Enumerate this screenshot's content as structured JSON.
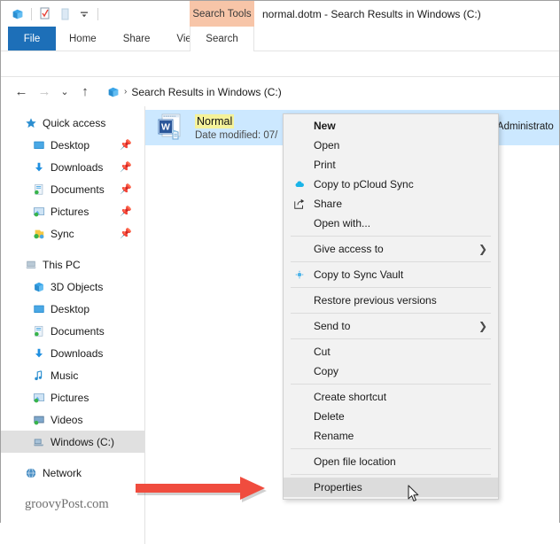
{
  "titlebar": {
    "quick_access_icons": [
      "explorer-icon",
      "properties-icon",
      "new-folder-icon",
      "customize-dropdown-icon"
    ],
    "contextual_tab_label": "Search Tools",
    "window_title": "normal.dotm - Search Results in Windows (C:)"
  },
  "ribbon": {
    "tabs": [
      {
        "label": "File",
        "active": true
      },
      {
        "label": "Home",
        "active": false
      },
      {
        "label": "Share",
        "active": false
      },
      {
        "label": "View",
        "active": false
      }
    ],
    "contextual_tab": {
      "label": "Search"
    }
  },
  "addressbar": {
    "back_label": "←",
    "forward_label": "→",
    "recent_label": "⌄",
    "up_label": "↑",
    "breadcrumb_chevron": "›",
    "path": "Search Results in Windows (C:)"
  },
  "sidebar": {
    "groups": [
      {
        "header": {
          "label": "Quick access",
          "icon": "star-icon"
        },
        "items": [
          {
            "label": "Desktop",
            "icon": "desktop-icon",
            "pinned": true
          },
          {
            "label": "Downloads",
            "icon": "downloads-icon",
            "pinned": true
          },
          {
            "label": "Documents",
            "icon": "documents-icon",
            "pinned": true
          },
          {
            "label": "Pictures",
            "icon": "pictures-icon",
            "pinned": true
          },
          {
            "label": "Sync",
            "icon": "sync-icon",
            "pinned": true
          }
        ]
      },
      {
        "header": {
          "label": "This PC",
          "icon": "this-pc-icon"
        },
        "items": [
          {
            "label": "3D Objects",
            "icon": "3d-objects-icon",
            "pinned": false
          },
          {
            "label": "Desktop",
            "icon": "desktop-icon",
            "pinned": false
          },
          {
            "label": "Documents",
            "icon": "documents-icon",
            "pinned": false
          },
          {
            "label": "Downloads",
            "icon": "downloads-icon",
            "pinned": false
          },
          {
            "label": "Music",
            "icon": "music-icon",
            "pinned": false
          },
          {
            "label": "Pictures",
            "icon": "pictures-icon",
            "pinned": false
          },
          {
            "label": "Videos",
            "icon": "videos-icon",
            "pinned": false
          },
          {
            "label": "Windows (C:)",
            "icon": "drive-icon",
            "pinned": false,
            "selected": true
          }
        ]
      },
      {
        "header": {
          "label": "Network",
          "icon": "network-icon"
        },
        "items": []
      }
    ]
  },
  "content": {
    "file": {
      "name": "Normal",
      "icon": "word-template-icon",
      "date_modified": "Date modified: 07/",
      "path": "C:\\Users\\Administrato"
    }
  },
  "context_menu": {
    "items": [
      {
        "label": "New",
        "bold": true,
        "icon": null,
        "submenu": false,
        "separator_after": false
      },
      {
        "label": "Open",
        "bold": false,
        "icon": null,
        "submenu": false,
        "separator_after": false
      },
      {
        "label": "Print",
        "bold": false,
        "icon": null,
        "submenu": false,
        "separator_after": false
      },
      {
        "label": "Copy to pCloud Sync",
        "bold": false,
        "icon": "pcloud-icon",
        "submenu": false,
        "separator_after": false
      },
      {
        "label": "Share",
        "bold": false,
        "icon": "share-icon",
        "submenu": false,
        "separator_after": false
      },
      {
        "label": "Open with...",
        "bold": false,
        "icon": null,
        "submenu": false,
        "separator_after": true
      },
      {
        "label": "Give access to",
        "bold": false,
        "icon": null,
        "submenu": true,
        "separator_after": true
      },
      {
        "label": "Copy to Sync Vault",
        "bold": false,
        "icon": "sync-vault-icon",
        "submenu": false,
        "separator_after": true
      },
      {
        "label": "Restore previous versions",
        "bold": false,
        "icon": null,
        "submenu": false,
        "separator_after": true
      },
      {
        "label": "Send to",
        "bold": false,
        "icon": null,
        "submenu": true,
        "separator_after": true
      },
      {
        "label": "Cut",
        "bold": false,
        "icon": null,
        "submenu": false,
        "separator_after": false
      },
      {
        "label": "Copy",
        "bold": false,
        "icon": null,
        "submenu": false,
        "separator_after": true
      },
      {
        "label": "Create shortcut",
        "bold": false,
        "icon": null,
        "submenu": false,
        "separator_after": false
      },
      {
        "label": "Delete",
        "bold": false,
        "icon": null,
        "submenu": false,
        "separator_after": false
      },
      {
        "label": "Rename",
        "bold": false,
        "icon": null,
        "submenu": false,
        "separator_after": true
      },
      {
        "label": "Open file location",
        "bold": false,
        "icon": null,
        "submenu": false,
        "separator_after": true
      },
      {
        "label": "Properties",
        "bold": false,
        "icon": null,
        "submenu": false,
        "separator_after": false,
        "highlighted": true
      }
    ]
  },
  "annotations": {
    "arrow_color": "#f04c3e",
    "watermark": "groovyPost.com"
  },
  "colors": {
    "file_tab": "#1d6fb8",
    "contextual_tab": "#f7c5a8",
    "selection": "#cce8ff",
    "highlight_text": "#f5f29a",
    "menu_bg": "#f2f2f2",
    "menu_hover": "#dcdcdc"
  }
}
